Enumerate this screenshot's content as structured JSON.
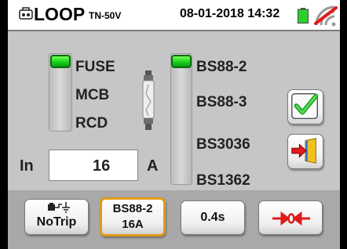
{
  "header": {
    "mode_label": "LOOP",
    "mode_sub": "TN-50V",
    "datetime": "08-01-2018 14:32",
    "mode_icon": "loop-mode-icon",
    "battery_icon": "battery-icon",
    "signal_icon": "no-signal-icon"
  },
  "protection": {
    "options": [
      "FUSE",
      "MCB",
      "RCD"
    ],
    "selected": "FUSE",
    "icon": "fuse-icon"
  },
  "fuse_type": {
    "options": [
      "BS88-2",
      "BS88-3",
      "BS3036",
      "BS1362"
    ],
    "selected": "BS88-2"
  },
  "current": {
    "label": "In",
    "value": "16",
    "unit": "A"
  },
  "actions": {
    "ok_icon": "checkmark-icon",
    "exit_icon": "exit-door-icon"
  },
  "bottom": {
    "notrip_label": "NoTrip",
    "notrip_icon": "earth-ground-icon",
    "type_line1": "BS88-2",
    "type_line2": "16A",
    "time_label": "0.4s",
    "zero_icon": "zero-calibration-icon"
  },
  "colors": {
    "selector_green": "#19d21b",
    "selected_outline": "#e09a15",
    "alert_red": "#e01b1b",
    "battery_green": "#2bd12b"
  }
}
